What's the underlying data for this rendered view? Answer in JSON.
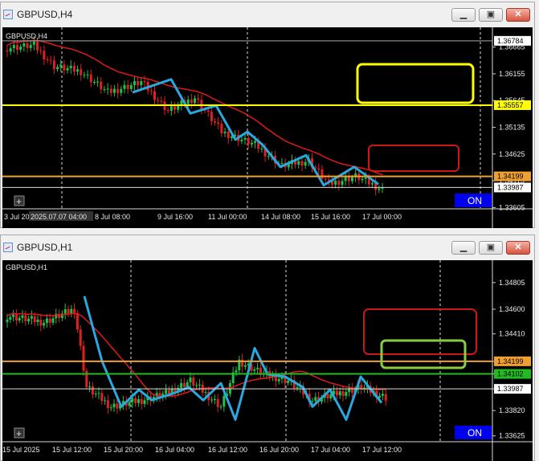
{
  "top": {
    "title": "GBPUSD,H4",
    "label": "GBPUSD,H4",
    "price_min": 1.3358,
    "price_max": 1.3695,
    "scale": [
      "1.36665",
      "1.36155",
      "1.35645",
      "1.35135",
      "1.34625",
      "1.34115",
      "1.33605"
    ],
    "tags": [
      {
        "text": "1.36784",
        "price": 1.36784,
        "bg": "#ffffff",
        "fg": "#000000"
      },
      {
        "text": "1.35557",
        "price": 1.35557,
        "bg": "#ffff00",
        "fg": "#000000"
      },
      {
        "text": "1.34199",
        "price": 1.34199,
        "bg": "#f0a030",
        "fg": "#000000"
      },
      {
        "text": "1.33987",
        "price": 1.33987,
        "bg": "#ffffff",
        "fg": "#000000"
      }
    ],
    "time_labels": [
      "3 Jul 20",
      "2025.07.07 04:00",
      "8 Jul 08:00",
      "9 Jul 16:00",
      "11 Jul 00:00",
      "14 Jul 08:00",
      "15 Jul 16:00",
      "17 Jul 00:00"
    ],
    "on_label": "ON",
    "plus_label": "+"
  },
  "bottom": {
    "title": "GBPUSD,H1",
    "label": "GBPUSD,H1",
    "price_min": 1.3358,
    "price_max": 1.3494,
    "scale": [
      "1.34805",
      "1.34600",
      "1.34410",
      "1.34199",
      "1.34102",
      "1.33987",
      "1.33820",
      "1.33625"
    ],
    "tags": [
      {
        "text": "1.34199",
        "price": 1.34199,
        "bg": "#f0a030",
        "fg": "#000000"
      },
      {
        "text": "1.34102",
        "price": 1.34102,
        "bg": "#22bb22",
        "fg": "#000000"
      },
      {
        "text": "1.33987",
        "price": 1.33987,
        "bg": "#ffffff",
        "fg": "#000000"
      }
    ],
    "time_labels": [
      "15 Jul 2025",
      "15 Jul 12:00",
      "15 Jul 20:00",
      "16 Jul 04:00",
      "16 Jul 12:00",
      "16 Jul 20:00",
      "17 Jul 04:00",
      "17 Jul 12:00"
    ],
    "on_label": "ON",
    "plus_label": "+"
  },
  "colors": {
    "bull": "#22c04a",
    "bear": "#e02020",
    "ma": "#e01818",
    "drawn": "#29a8e0",
    "yellow": "#ffff00",
    "orange": "#f0a030",
    "green": "#22bb22"
  }
}
